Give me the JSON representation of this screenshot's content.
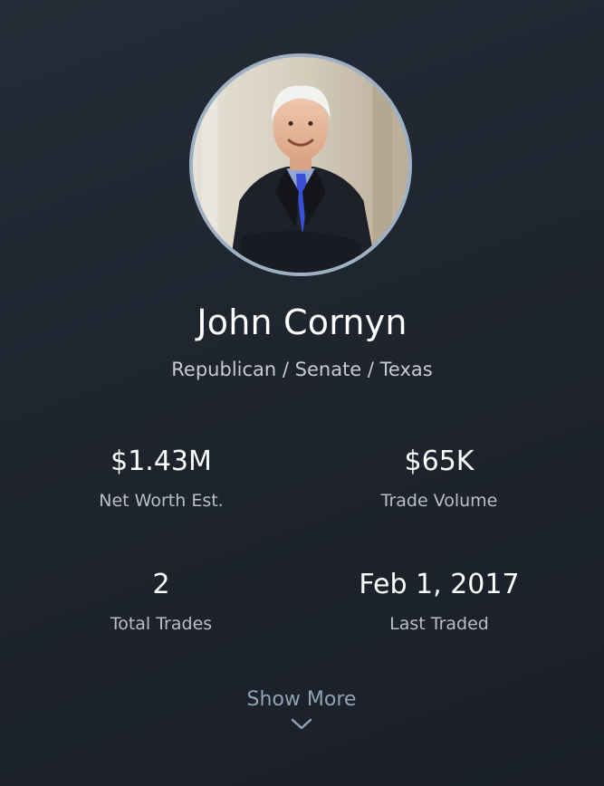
{
  "profile": {
    "name": "John Cornyn",
    "affiliation": "Republican / Senate / Texas"
  },
  "stats": {
    "net_worth": {
      "value": "$1.43M",
      "label": "Net Worth Est."
    },
    "trade_volume": {
      "value": "$65K",
      "label": "Trade Volume"
    },
    "total_trades": {
      "value": "2",
      "label": "Total Trades"
    },
    "last_traded": {
      "value": "Feb 1, 2017",
      "label": "Last Traded"
    }
  },
  "actions": {
    "show_more_label": "Show More",
    "show_more_icon": "chevron-down-icon"
  },
  "colors": {
    "background": "#1f252f",
    "avatar_border": "#9db0c4",
    "label_text": "#b9bfc9",
    "link_text": "#8fa3b6"
  }
}
